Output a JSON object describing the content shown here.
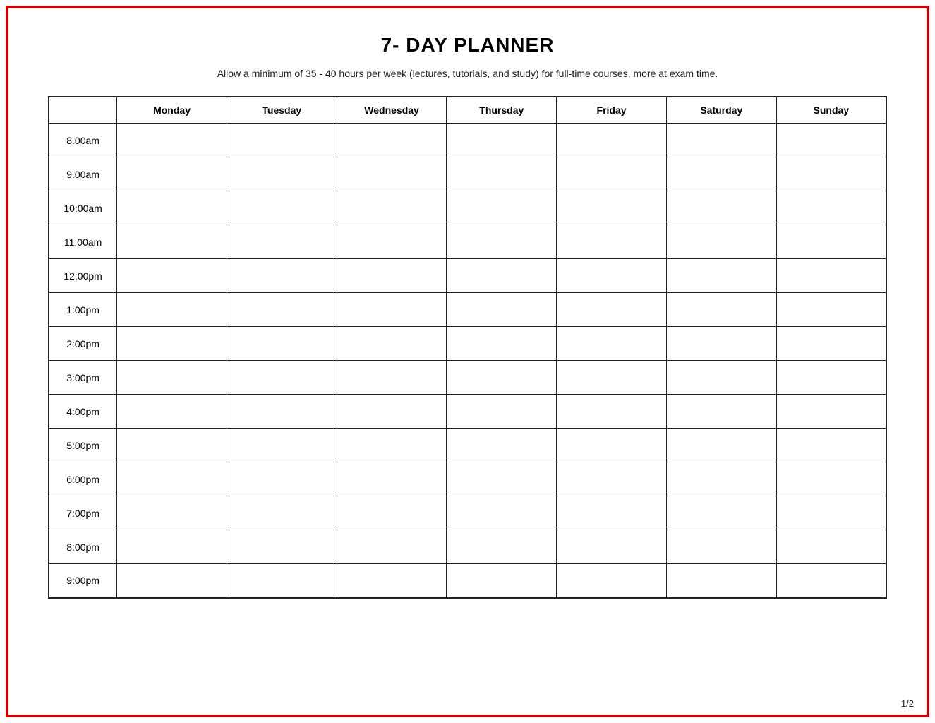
{
  "title": "7- DAY PLANNER",
  "subtitle": "Allow a minimum of 35 - 40 hours per week (lectures, tutorials, and study) for full-time courses, more at exam time.",
  "page_number": "1/2",
  "columns": {
    "time_header": "",
    "days": [
      "Monday",
      "Tuesday",
      "Wednesday",
      "Thursday",
      "Friday",
      "Saturday",
      "Sunday"
    ]
  },
  "time_slots": [
    "8.00am",
    "9.00am",
    "10:00am",
    "11:00am",
    "12:00pm",
    "1:00pm",
    "2:00pm",
    "3:00pm",
    "4:00pm",
    "5:00pm",
    "6:00pm",
    "7:00pm",
    "8:00pm",
    "9:00pm"
  ]
}
